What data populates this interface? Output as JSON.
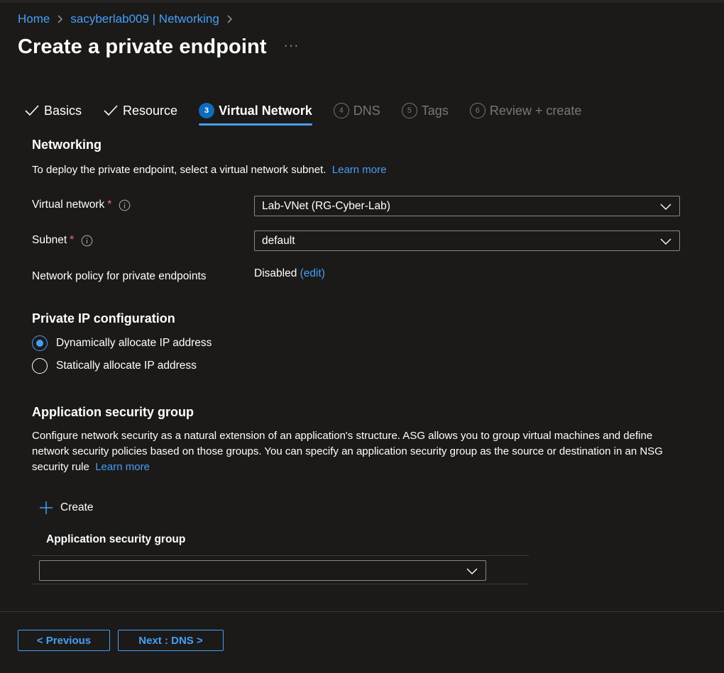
{
  "breadcrumb": {
    "home": "Home",
    "parent": "sacyberlab009 | Networking"
  },
  "page": {
    "title": "Create a private endpoint",
    "more": "···"
  },
  "tabs": [
    {
      "label": "Basics",
      "state": "done"
    },
    {
      "label": "Resource",
      "state": "done"
    },
    {
      "number": "3",
      "label": "Virtual Network",
      "state": "active"
    },
    {
      "number": "4",
      "label": "DNS",
      "state": "future"
    },
    {
      "number": "5",
      "label": "Tags",
      "state": "future"
    },
    {
      "number": "6",
      "label": "Review + create",
      "state": "future"
    }
  ],
  "networking": {
    "title": "Networking",
    "description": "To deploy the private endpoint, select a virtual network subnet.",
    "learn_more": "Learn more",
    "virtual_network_label": "Virtual network",
    "virtual_network_value": "Lab-VNet (RG-Cyber-Lab)",
    "subnet_label": "Subnet",
    "subnet_value": "default",
    "required_mark": "*",
    "policy_label": "Network policy for private endpoints",
    "policy_value": "Disabled",
    "policy_edit": "(edit)"
  },
  "ip_config": {
    "title": "Private IP configuration",
    "options": [
      {
        "label": "Dynamically allocate IP address",
        "checked": true
      },
      {
        "label": "Statically allocate IP address",
        "checked": false
      }
    ]
  },
  "asg": {
    "title": "Application security group",
    "description": "Configure network security as a natural extension of an application's structure. ASG allows you to group virtual machines and define network security policies based on those groups. You can specify an application security group as the source or destination in an NSG security rule",
    "learn_more": "Learn more",
    "create_label": "Create",
    "column_header": "Application security group",
    "select_value": ""
  },
  "footer": {
    "previous_label": "< Previous",
    "next_label": "Next : DNS >"
  },
  "colors": {
    "background": "#1b1a19",
    "accent": "#479ef5",
    "active_step": "#0f6cbd",
    "required": "#f1707b",
    "muted": "#797775"
  },
  "icons": {
    "breadcrumb_separator": "chevron-right-icon",
    "done_tab": "checkmark-icon",
    "info": "info-icon",
    "dropdown": "chevron-down-icon",
    "create": "plus-icon"
  }
}
